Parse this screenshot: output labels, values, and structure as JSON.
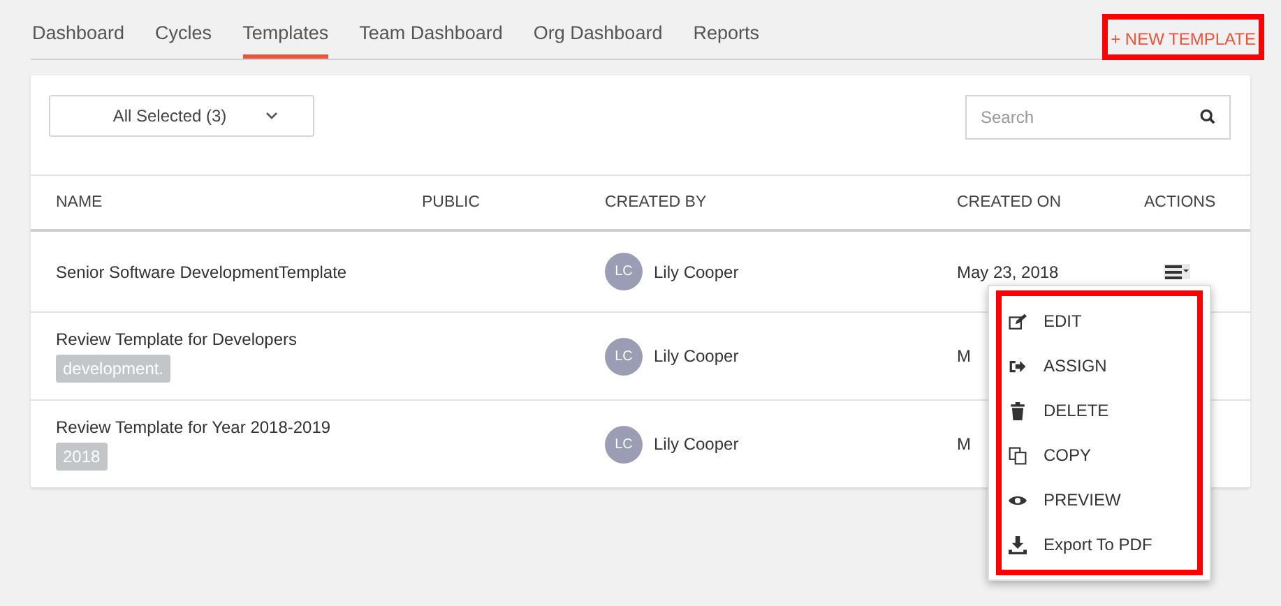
{
  "tabs": [
    {
      "label": "Dashboard",
      "selected": false
    },
    {
      "label": "Cycles",
      "selected": false
    },
    {
      "label": "Templates",
      "selected": true
    },
    {
      "label": "Team Dashboard",
      "selected": false
    },
    {
      "label": "Org Dashboard",
      "selected": false
    },
    {
      "label": "Reports",
      "selected": false
    }
  ],
  "new_template_button": {
    "label": "+ NEW TEMPLATE",
    "highlighted": true
  },
  "filter": {
    "value": "All Selected (3)"
  },
  "search": {
    "placeholder": "Search"
  },
  "table": {
    "columns": [
      "NAME",
      "PUBLIC",
      "CREATED BY",
      "CREATED ON",
      "ACTIONS"
    ],
    "rows": [
      {
        "name": "Senior Software DevelopmentTemplate",
        "tag": null,
        "initials": "LC",
        "created_by": "Lily Cooper",
        "created_on": "May 23, 2018",
        "menu_open": true
      },
      {
        "name": "Review Template for Developers",
        "tag": "development.",
        "initials": "LC",
        "created_by": "Lily Cooper",
        "created_on": "M",
        "menu_open": false
      },
      {
        "name": "Review Template for Year 2018-2019",
        "tag": "2018",
        "initials": "LC",
        "created_by": "Lily Cooper",
        "created_on": "M",
        "menu_open": false
      }
    ]
  },
  "actions_menu": {
    "highlighted": true,
    "items": [
      {
        "kind": "edit",
        "label": "EDIT"
      },
      {
        "kind": "assign",
        "label": "ASSIGN"
      },
      {
        "kind": "delete",
        "label": "DELETE"
      },
      {
        "kind": "copy",
        "label": "COPY"
      },
      {
        "kind": "preview",
        "label": "PREVIEW"
      },
      {
        "kind": "export",
        "label": "Export To PDF"
      }
    ]
  }
}
